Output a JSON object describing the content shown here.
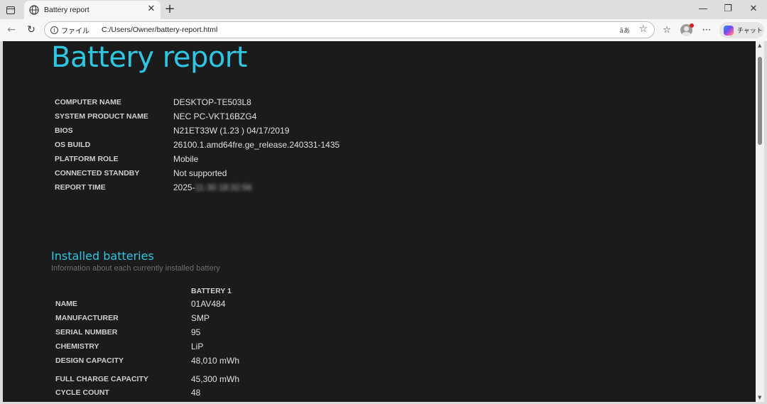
{
  "browser": {
    "tab_title": "Battery report",
    "address_scheme": "ファイル",
    "address_url": "C:/Users/Owner/battery-report.html",
    "read_aloud_label": "ãあ",
    "chat_label": "チャット",
    "colors": {
      "accent": "#2ec6e2",
      "page_bg": "#1b1b1c"
    }
  },
  "report": {
    "title": "Battery report",
    "system_info": [
      {
        "label": "COMPUTER NAME",
        "value": "DESKTOP-TE503L8"
      },
      {
        "label": "SYSTEM PRODUCT NAME",
        "value": "NEC PC-VKT16BZG4"
      },
      {
        "label": "BIOS",
        "value": "N21ET33W (1.23 ) 04/17/2019"
      },
      {
        "label": "OS BUILD",
        "value": "26100.1.amd64fre.ge_release.240331-1435"
      },
      {
        "label": "PLATFORM ROLE",
        "value": "Mobile"
      },
      {
        "label": "CONNECTED STANDBY",
        "value": "Not supported"
      },
      {
        "label": "REPORT TIME",
        "value": "2025-",
        "value_obscured": "11-30  18:32:56"
      }
    ],
    "installed_batteries": {
      "title": "Installed batteries",
      "subtitle": "Information about each currently installed battery",
      "column_header": "BATTERY 1",
      "rows": [
        {
          "label": "NAME",
          "value": "01AV484"
        },
        {
          "label": "MANUFACTURER",
          "value": "SMP"
        },
        {
          "label": "SERIAL NUMBER",
          "value": "95"
        },
        {
          "label": "CHEMISTRY",
          "value": "LiP"
        },
        {
          "label": "DESIGN CAPACITY",
          "value": "48,010 mWh"
        },
        {
          "label": "FULL CHARGE CAPACITY",
          "value": "45,300 mWh"
        },
        {
          "label": "CYCLE COUNT",
          "value": "48"
        }
      ]
    }
  }
}
